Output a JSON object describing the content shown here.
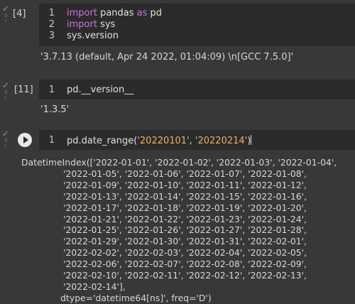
{
  "cell1": {
    "exec_count": "[4]",
    "lines": [
      {
        "num": "1",
        "kw1": "import",
        "a": " pandas ",
        "kw2": "as",
        "b": " pd"
      },
      {
        "num": "2",
        "kw1": "import",
        "a": " sys"
      },
      {
        "num": "3",
        "plain": "sys.version"
      }
    ],
    "output": "'3.7.13 (default, Apr 24 2022, 01:04:09) \\n[GCC 7.5.0]'"
  },
  "cell2": {
    "exec_count": "[11]",
    "line": {
      "num": "1",
      "plain": "pd.__version__"
    },
    "output": "'1.3.5'"
  },
  "cell3": {
    "line": {
      "num": "1",
      "pre": "pd.date_range(",
      "s1": "'20220101'",
      "mid": ", ",
      "s2": "'20220214'",
      "post": ")"
    },
    "output_lines": [
      "DatetimeIndex(['2022-01-01', '2022-01-02', '2022-01-03', '2022-01-04',",
      "               '2022-01-05', '2022-01-06', '2022-01-07', '2022-01-08',",
      "               '2022-01-09', '2022-01-10', '2022-01-11', '2022-01-12',",
      "               '2022-01-13', '2022-01-14', '2022-01-15', '2022-01-16',",
      "               '2022-01-17', '2022-01-18', '2022-01-19', '2022-01-20',",
      "               '2022-01-21', '2022-01-22', '2022-01-23', '2022-01-24',",
      "               '2022-01-25', '2022-01-26', '2022-01-27', '2022-01-28',",
      "               '2022-01-29', '2022-01-30', '2022-01-31', '2022-02-01',",
      "               '2022-02-02', '2022-02-03', '2022-02-04', '2022-02-05',",
      "               '2022-02-06', '2022-02-07', '2022-02-08', '2022-02-09',",
      "               '2022-02-10', '2022-02-11', '2022-02-12', '2022-02-13',",
      "               '2022-02-14'],",
      "              dtype='datetime64[ns]', freq='D')"
    ]
  },
  "gutter": {
    "check_glyph": "✓",
    "zero_glyph": "0",
    "tiny_glyph": "s"
  },
  "colors": {
    "keyword": "#c678dd",
    "string": "#e5b567",
    "success": "#5fb760",
    "code_bg": "#2b2b2b",
    "page_bg": "#383838"
  }
}
